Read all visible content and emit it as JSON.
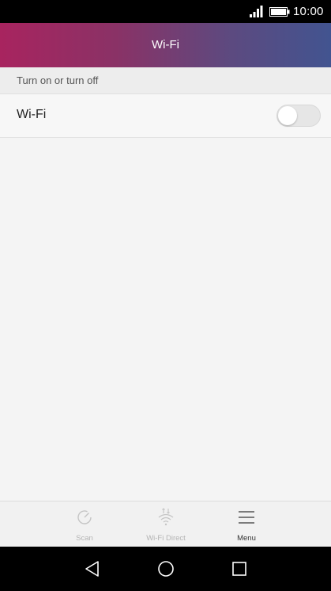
{
  "status_bar": {
    "time": "10:00",
    "signal_icon": "signal-icon",
    "battery_icon": "battery-icon"
  },
  "app_bar": {
    "title": "Wi-Fi"
  },
  "section": {
    "header": "Turn on or turn off"
  },
  "wifi_row": {
    "label": "Wi-Fi",
    "toggle_on": false
  },
  "toolbar": {
    "items": [
      {
        "label": "Scan",
        "icon": "scan-icon",
        "enabled": false
      },
      {
        "label": "Wi-Fi Direct",
        "icon": "wifi-direct-icon",
        "enabled": false
      },
      {
        "label": "Menu",
        "icon": "menu-icon",
        "enabled": true
      }
    ]
  },
  "nav_bar": {
    "back_icon": "back-icon",
    "home_icon": "home-icon",
    "recent_icon": "recent-apps-icon"
  },
  "colors": {
    "app_bar_gradient_start": "#a8245f",
    "app_bar_gradient_end": "#425490",
    "background": "#f4f4f4"
  }
}
